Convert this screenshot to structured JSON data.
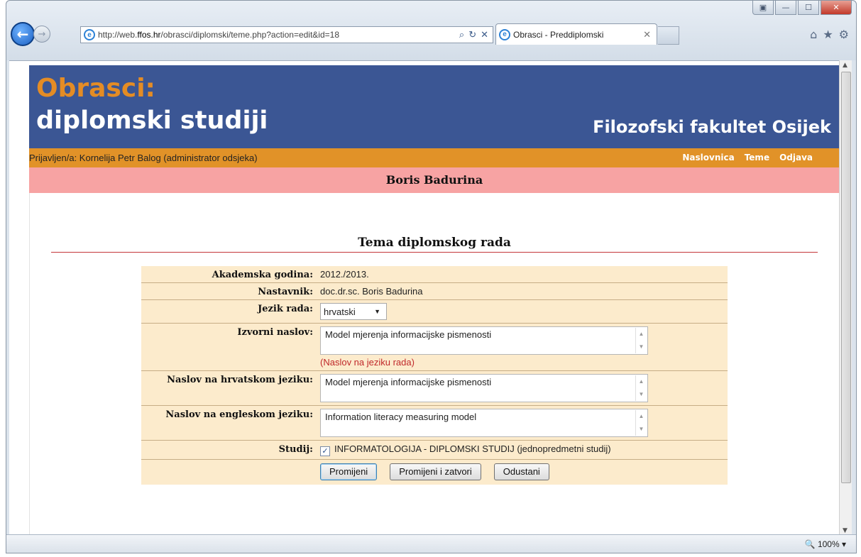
{
  "browser": {
    "url_prefix": "http://web.",
    "url_domain": "ffos.hr",
    "url_path": "/obrasci/diplomski/teme.php?action=edit&id=18",
    "tab_title": "Obrasci - Preddiplomski",
    "zoom": "100%"
  },
  "page": {
    "banner_line1": "Obrasci:",
    "banner_line2": "diplomski studiji",
    "faculty": "Filozofski fakultet Osijek",
    "logged_in": "Prijavljen/a: Kornelija Petr Balog (administrator odsjeka)",
    "menu": [
      "Naslovnica",
      "Teme",
      "Odjava"
    ],
    "student_name": "Boris Badurina",
    "section_title": "Tema diplomskog rada"
  },
  "form": {
    "year_label": "Akademska godina:",
    "year_value": "2012./2013.",
    "teacher_label": "Nastavnik:",
    "teacher_value": "doc.dr.sc. Boris Badurina",
    "language_label": "Jezik rada:",
    "language_value": "hrvatski",
    "orig_title_label": "Izvorni naslov:",
    "orig_title_value": "Model mjerenja informacijske pismenosti",
    "orig_title_hint": "(Naslov na jeziku rada)",
    "hr_title_label": "Naslov na hrvatskom jeziku:",
    "hr_title_value": "Model mjerenja informacijske pismenosti",
    "en_title_label": "Naslov na engleskom jeziku:",
    "en_title_value": "Information literacy measuring model",
    "study_label": "Studij:",
    "study_value": "INFORMATOLOGIJA - DIPLOMSKI STUDIJ (jednopredmetni studij)",
    "btn_change": "Promijeni",
    "btn_change_close": "Promijeni i zatvori",
    "btn_cancel": "Odustani"
  }
}
